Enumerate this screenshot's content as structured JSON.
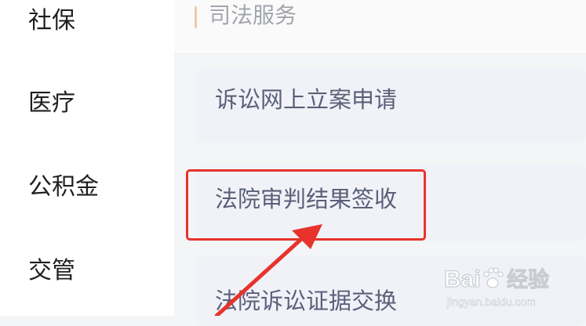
{
  "sidebar": {
    "items": [
      {
        "label": "社保"
      },
      {
        "label": "医疗"
      },
      {
        "label": "公积金"
      },
      {
        "label": "交管"
      }
    ]
  },
  "section": {
    "title": "司法服务"
  },
  "services": [
    {
      "label": "诉讼网上立案申请"
    },
    {
      "label": "法院审判结果签收"
    },
    {
      "label": "法院诉讼证据交换"
    }
  ],
  "watermark": {
    "brand": "Baidu经验",
    "url": "jingyan.baidu.com"
  },
  "colors": {
    "highlight": "#e8322c",
    "section_accent": "#f1c9a0",
    "card_background": "#f1f2f8",
    "card_text": "#5b6079"
  }
}
